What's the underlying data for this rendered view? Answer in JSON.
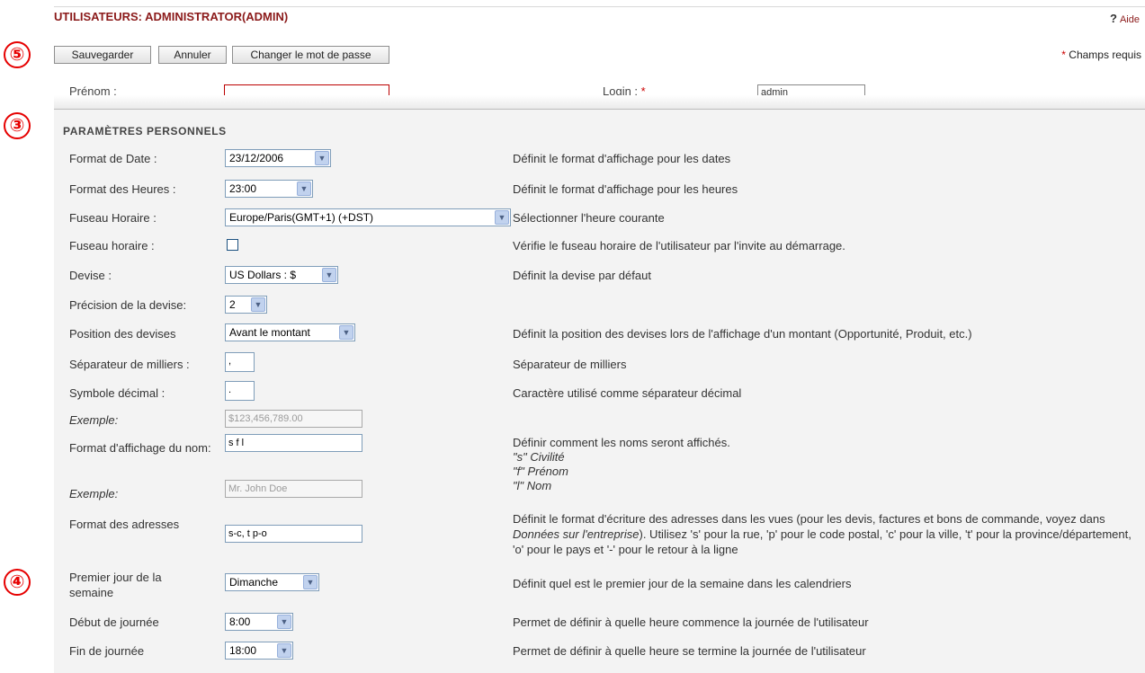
{
  "header": {
    "title": "UTILISATEURS: ADMINISTRATOR(ADMIN)",
    "help_icon": "?",
    "help_label": "Aide"
  },
  "toolbar": {
    "save_label": "Sauvegarder",
    "cancel_label": "Annuler",
    "change_password_label": "Changer le mot de passe",
    "required_star": "*",
    "required_label": "Champs requis"
  },
  "callouts": [
    "⑤",
    "③",
    "④"
  ],
  "cut_row": {
    "firstname_label": "Prénom :",
    "login_label": "Login :",
    "login_star": "*",
    "login_value": "admin"
  },
  "section": {
    "title": "PARAMÈTRES PERSONNELS",
    "rows": {
      "date_format": {
        "label": "Format de Date :",
        "value": "23/12/2006",
        "desc": "Définit le format d'affichage pour les dates"
      },
      "time_format": {
        "label": "Format des Heures :",
        "value": "23:00",
        "desc": "Définit le format d'affichage pour les heures"
      },
      "timezone": {
        "label": "Fuseau Horaire :",
        "value": "Europe/Paris(GMT+1) (+DST)",
        "desc": "Sélectionner l'heure courante"
      },
      "timezone_check": {
        "label": "Fuseau horaire :",
        "checked": false,
        "desc": "Vérifie le fuseau horaire de l'utilisateur par l'invite au démarrage."
      },
      "currency": {
        "label": "Devise :",
        "value": "US Dollars : $",
        "desc": "Définit la devise par défaut"
      },
      "currency_precision": {
        "label": "Précision de la devise:",
        "value": "2"
      },
      "currency_position": {
        "label": "Position des devises",
        "value": "Avant le montant",
        "desc": "Définit la position des devises lors de l'affichage d'un montant (Opportunité, Produit, etc.)"
      },
      "thousands_sep": {
        "label": "Séparateur de milliers :",
        "value": ",",
        "desc": "Séparateur de milliers"
      },
      "decimal_symbol": {
        "label": "Symbole décimal :",
        "value": ".",
        "desc": "Caractère utilisé comme séparateur décimal"
      },
      "example_number": {
        "label": "Exemple:",
        "value": "$123,456,789.00"
      },
      "name_format": {
        "label": "Format d'affichage du nom:",
        "value": "s f l",
        "desc_line1": "Définir comment les noms seront affichés.",
        "desc_line2": "\"s\" Civilité",
        "desc_line3": "\"f\" Prénom",
        "desc_line4": "\"l\" Nom"
      },
      "example_name": {
        "label": "Exemple:",
        "value": "Mr. John Doe"
      },
      "address_format": {
        "label": "Format des adresses",
        "value": "s-c, t p-o",
        "desc_before": "Définit le format d'écriture des adresses dans les vues (pour les devis, factures et bons de commande, voyez dans ",
        "desc_italic": "Données sur l'entreprise",
        "desc_after": "). Utilisez 's' pour la rue, 'p' pour le code postal, 'c' pour la ville, 't' pour la province/département, 'o' pour le pays et '-' pour le retour à la ligne"
      },
      "first_day": {
        "label": "Premier jour de la semaine",
        "value": "Dimanche",
        "desc": "Définit quel est le premier jour de la semaine dans les calendriers"
      },
      "day_start": {
        "label": "Début de journée",
        "value": "8:00",
        "desc": "Permet de définir à quelle heure commence la journée de l'utilisateur"
      },
      "day_end": {
        "label": "Fin de journée",
        "value": "18:00",
        "desc": "Permet de définir à quelle heure se termine la journée de l'utilisateur"
      }
    }
  },
  "icons": {
    "dropdown": "chevron-down-icon",
    "help": "question-icon"
  },
  "colors": {
    "title": "#8b1a1a",
    "required": "#cc0000",
    "callout": "#e60000",
    "panel": "#f3f3f3"
  }
}
